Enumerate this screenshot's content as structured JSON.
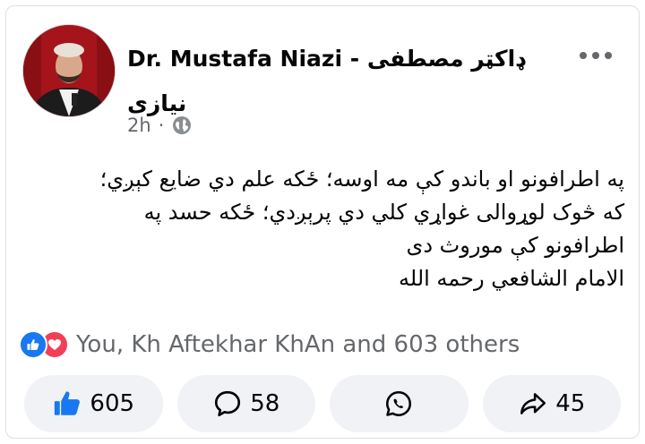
{
  "post": {
    "author_name": "Dr. Mustafa Niazi",
    "author_separator": " - ",
    "author_urdu_part1": "ډاکټر مصطفی",
    "author_urdu_part2": "نیازی",
    "time": "2h",
    "meta_separator": "·",
    "privacy_icon": "globe-icon",
    "lines": [
      "په اطرافونو او باندو کې مه اوسه؛ ځکه علم دي ضایع کېږي؛",
      "که څوک لوړوالی غواړي کلي دي پرېږدي؛ ځکه حسد په",
      "اطرافونو کې موروث دی",
      "الامام الشافعي رحمه الله"
    ]
  },
  "reactions": {
    "icons": [
      "like-icon",
      "love-icon"
    ],
    "summary": "You, Kh Aftekhar KhAn and 603 others"
  },
  "actions": {
    "like_count": "605",
    "comment_count": "58",
    "share_count": "45"
  },
  "colors": {
    "accent": "#1877f2",
    "love": "#f33e58",
    "secondary_text": "#65676b",
    "button_bg": "#f0f2f5"
  }
}
